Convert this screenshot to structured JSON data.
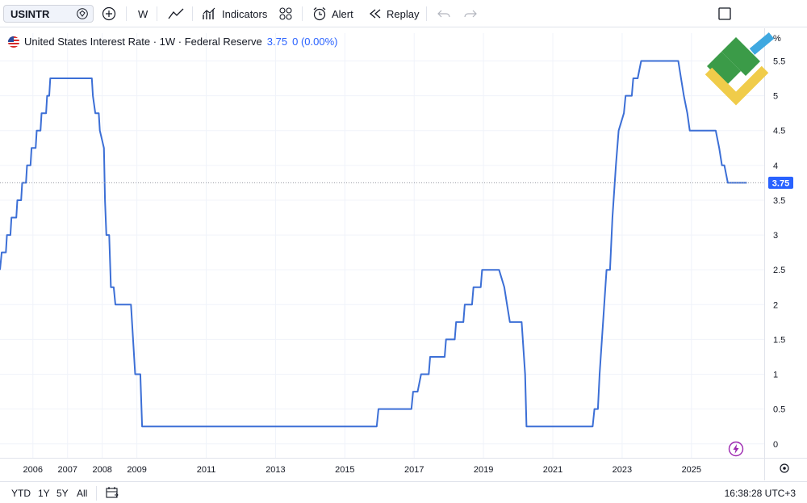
{
  "toolbar": {
    "symbol": "USINTR",
    "interval": "W",
    "indicators_label": "Indicators",
    "alert_label": "Alert",
    "replay_label": "Replay"
  },
  "legend": {
    "title": "United States Interest Rate · 1W · Federal Reserve",
    "value": "3.75",
    "change": "0 (0.00%)"
  },
  "bottom": {
    "ranges": [
      "YTD",
      "1Y",
      "5Y",
      "All"
    ],
    "clock": "16:38:28 UTC+3"
  },
  "colors": {
    "line": "#3c6fd6",
    "accent": "#2962ff",
    "grid": "#f0f3fa"
  },
  "chart_data": {
    "type": "line",
    "title": "United States Interest Rate · 1W · Federal Reserve",
    "x_ticks": [
      "2006",
      "2007",
      "2008",
      "2009",
      "2011",
      "2013",
      "2015",
      "2017",
      "2019",
      "2021",
      "2023",
      "2025"
    ],
    "y_ticks": [
      "0",
      "0.5",
      "1",
      "1.5",
      "2",
      "2.5",
      "3",
      "3.5",
      "4",
      "4.5",
      "5",
      "5.5"
    ],
    "y_unit": "%",
    "ylim": [
      -0.2,
      5.9
    ],
    "xlim": [
      2005.05,
      2027.1
    ],
    "last_value_label": "3.75",
    "grid": true,
    "series": [
      {
        "points": [
          [
            2005.05,
            2.5
          ],
          [
            2005.1,
            2.75
          ],
          [
            2005.22,
            2.75
          ],
          [
            2005.25,
            3.0
          ],
          [
            2005.35,
            3.0
          ],
          [
            2005.38,
            3.25
          ],
          [
            2005.52,
            3.25
          ],
          [
            2005.55,
            3.5
          ],
          [
            2005.66,
            3.5
          ],
          [
            2005.69,
            3.75
          ],
          [
            2005.8,
            3.75
          ],
          [
            2005.83,
            4.0
          ],
          [
            2005.93,
            4.0
          ],
          [
            2005.96,
            4.25
          ],
          [
            2006.08,
            4.25
          ],
          [
            2006.11,
            4.5
          ],
          [
            2006.22,
            4.5
          ],
          [
            2006.25,
            4.75
          ],
          [
            2006.38,
            4.75
          ],
          [
            2006.41,
            5.0
          ],
          [
            2006.47,
            5.0
          ],
          [
            2006.5,
            5.25
          ],
          [
            2007.7,
            5.25
          ],
          [
            2007.73,
            5.0
          ],
          [
            2007.8,
            4.75
          ],
          [
            2007.9,
            4.75
          ],
          [
            2007.93,
            4.5
          ],
          [
            2008.05,
            4.25
          ],
          [
            2008.08,
            3.5
          ],
          [
            2008.12,
            3.0
          ],
          [
            2008.2,
            3.0
          ],
          [
            2008.25,
            2.25
          ],
          [
            2008.33,
            2.25
          ],
          [
            2008.38,
            2.0
          ],
          [
            2008.83,
            2.0
          ],
          [
            2008.95,
            1.0
          ],
          [
            2009.1,
            1.0
          ],
          [
            2009.15,
            0.25
          ],
          [
            2015.92,
            0.25
          ],
          [
            2015.97,
            0.5
          ],
          [
            2016.92,
            0.5
          ],
          [
            2016.97,
            0.75
          ],
          [
            2017.1,
            0.75
          ],
          [
            2017.2,
            1.0
          ],
          [
            2017.42,
            1.0
          ],
          [
            2017.46,
            1.25
          ],
          [
            2017.88,
            1.25
          ],
          [
            2017.92,
            1.5
          ],
          [
            2018.17,
            1.5
          ],
          [
            2018.21,
            1.75
          ],
          [
            2018.42,
            1.75
          ],
          [
            2018.46,
            2.0
          ],
          [
            2018.67,
            2.0
          ],
          [
            2018.71,
            2.25
          ],
          [
            2018.92,
            2.25
          ],
          [
            2018.96,
            2.5
          ],
          [
            2019.45,
            2.5
          ],
          [
            2019.6,
            2.25
          ],
          [
            2019.68,
            2.0
          ],
          [
            2019.76,
            1.75
          ],
          [
            2020.1,
            1.75
          ],
          [
            2020.2,
            1.0
          ],
          [
            2020.24,
            0.25
          ],
          [
            2022.15,
            0.25
          ],
          [
            2022.2,
            0.5
          ],
          [
            2022.3,
            0.5
          ],
          [
            2022.35,
            1.0
          ],
          [
            2022.45,
            1.75
          ],
          [
            2022.55,
            2.5
          ],
          [
            2022.65,
            2.5
          ],
          [
            2022.72,
            3.25
          ],
          [
            2022.82,
            4.0
          ],
          [
            2022.9,
            4.5
          ],
          [
            2023.05,
            4.75
          ],
          [
            2023.1,
            5.0
          ],
          [
            2023.28,
            5.0
          ],
          [
            2023.32,
            5.25
          ],
          [
            2023.45,
            5.25
          ],
          [
            2023.55,
            5.5
          ],
          [
            2024.62,
            5.5
          ],
          [
            2024.7,
            5.25
          ],
          [
            2024.78,
            5.0
          ],
          [
            2024.88,
            4.75
          ],
          [
            2024.95,
            4.5
          ],
          [
            2025.7,
            4.5
          ],
          [
            2025.8,
            4.25
          ],
          [
            2025.88,
            4.0
          ],
          [
            2025.95,
            4.0
          ],
          [
            2026.05,
            3.75
          ],
          [
            2026.6,
            3.75
          ]
        ]
      }
    ]
  }
}
